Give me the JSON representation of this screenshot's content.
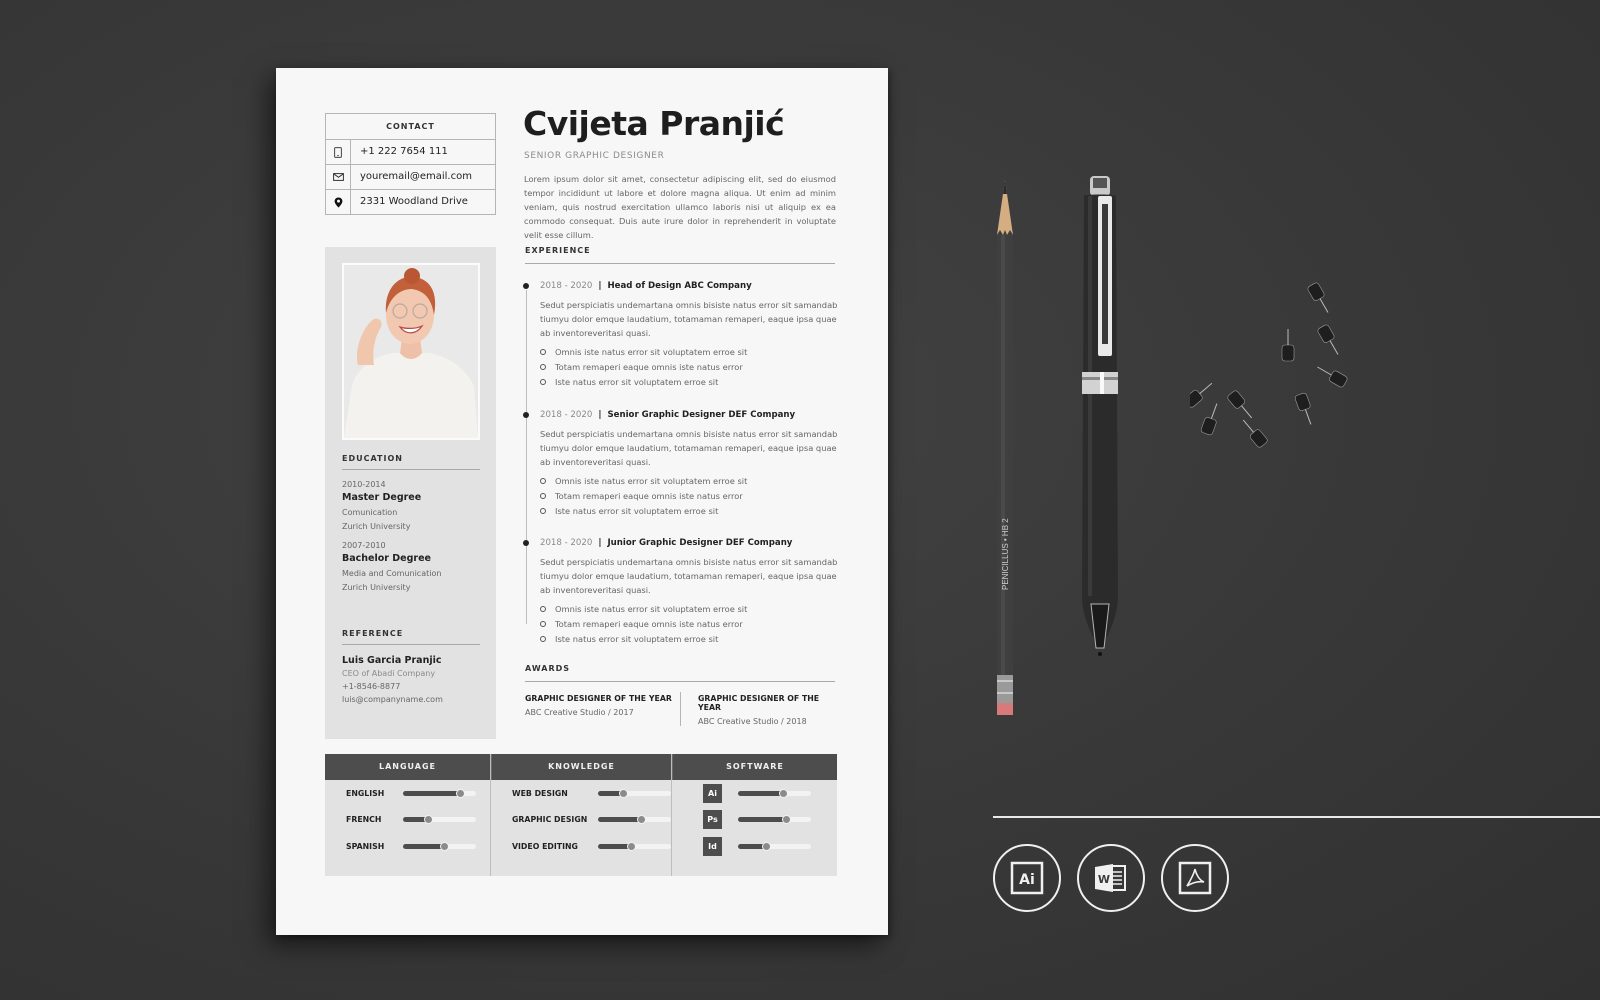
{
  "resume": {
    "name": "Cvijeta Pranjić",
    "job_title": "SENIOR GRAPHIC DESIGNER",
    "intro": "Lorem ipsum dolor sit amet, consectetur adipiscing elit, sed do eiusmod tempor incididunt ut labore et dolore magna aliqua. Ut enim ad minim veniam, quis nostrud exercitation ullamco laboris nisi ut aliquip ex ea commodo consequat. Duis aute irure dolor in reprehenderit in voluptate velit esse cillum.",
    "contact": {
      "title": "CONTACT",
      "items": [
        {
          "icon": "phone-icon",
          "text": "+1 222 7654 111"
        },
        {
          "icon": "mail-icon",
          "text": "youremail@email.com"
        },
        {
          "icon": "location-pin-icon",
          "text": "2331 Woodland Drive"
        }
      ]
    },
    "education": {
      "title": "EDUCATION",
      "items": [
        {
          "years": "2010-2014",
          "degree": "Master Degree",
          "field": "Comunication",
          "school": "Zurich University"
        },
        {
          "years": "2007-2010",
          "degree": "Bachelor Degree",
          "field": "Media and Comunication",
          "school": "Zurich University"
        }
      ]
    },
    "reference": {
      "title": "REFERENCE",
      "name": "Luis Garcia Pranjic",
      "role": "CEO of Abadi Company",
      "phone": "+1-8546-8877",
      "email": "luis@companyname.com"
    },
    "experience": {
      "title": "EXPERIENCE",
      "jobs": [
        {
          "years": "2018 - 2020",
          "separator": "|",
          "title": "Head of Design ABC Company",
          "description": "Sedut perspiciatis undemartana omnis bisiste natus error sit samandab tiumyu dolor emque laudatium, totamaman remaperi, eaque ipsa quae ab inventoreveritasi quasi.",
          "bullets": [
            "Omnis iste natus error sit voluptatem erroe sit",
            "Totam remaperi eaque omnis iste natus error",
            "Iste natus error sit voluptatem erroe sit"
          ]
        },
        {
          "years": "2018 - 2020",
          "separator": "|",
          "title": "Senior Graphic Designer DEF Company",
          "description": "Sedut perspiciatis undemartana omnis bisiste natus error sit samandab tiumyu dolor emque laudatium, totamaman remaperi, eaque ipsa quae ab inventoreveritasi quasi.",
          "bullets": [
            "Omnis iste natus error sit voluptatem erroe sit",
            "Totam remaperi eaque omnis iste natus error",
            "Iste natus error sit voluptatem erroe sit"
          ]
        },
        {
          "years": "2018 - 2020",
          "separator": "|",
          "title": "Junior Graphic Designer DEF Company",
          "description": "Sedut perspiciatis undemartana omnis bisiste natus error sit samandab tiumyu dolor emque laudatium, totamaman remaperi, eaque ipsa quae ab inventoreveritasi quasi.",
          "bullets": [
            "Omnis iste natus error sit voluptatem erroe sit",
            "Totam remaperi eaque omnis iste natus error",
            "Iste natus error sit voluptatem erroe sit"
          ]
        }
      ]
    },
    "awards": {
      "title": "AWARDS",
      "items": [
        {
          "title": "GRAPHIC DESIGNER OF THE YEAR",
          "sub": "ABC Creative Studio / 2017"
        },
        {
          "title": "GRAPHIC DESIGNER  OF THE YEAR",
          "sub": "ABC Creative Studio / 2018"
        }
      ]
    },
    "skills": {
      "language": {
        "title": "LANGUAGE",
        "items": [
          {
            "label": "ENGLISH",
            "level": 0.8
          },
          {
            "label": "FRENCH",
            "level": 0.35
          },
          {
            "label": "SPANISH",
            "level": 0.57
          }
        ]
      },
      "knowledge": {
        "title": "KNOWLEDGE",
        "items": [
          {
            "label": "WEB DESIGN",
            "level": 0.36
          },
          {
            "label": "GRAPHIC DESIGN",
            "level": 0.6
          },
          {
            "label": "VIDEO EDITING",
            "level": 0.46
          }
        ]
      },
      "software": {
        "title": "SOFTWARE",
        "items": [
          {
            "label": "Ai",
            "level": 0.63
          },
          {
            "label": "Ps",
            "level": 0.67
          },
          {
            "label": "Id",
            "level": 0.4
          }
        ]
      }
    }
  },
  "desk": {
    "pencil_text": "PENICILLUS  •  HB 2",
    "format_icons": [
      {
        "name": "illustrator-icon",
        "label": "Ai"
      },
      {
        "name": "word-icon",
        "label": "W"
      },
      {
        "name": "pdf-icon",
        "label": ""
      }
    ]
  },
  "colors": {
    "background": "#3a3a3a",
    "paper": "#f7f7f7",
    "sidebar": "#e2e2e2",
    "header_bar": "#4d4d4d",
    "text_dark": "#222222",
    "text_muted": "#666666"
  }
}
